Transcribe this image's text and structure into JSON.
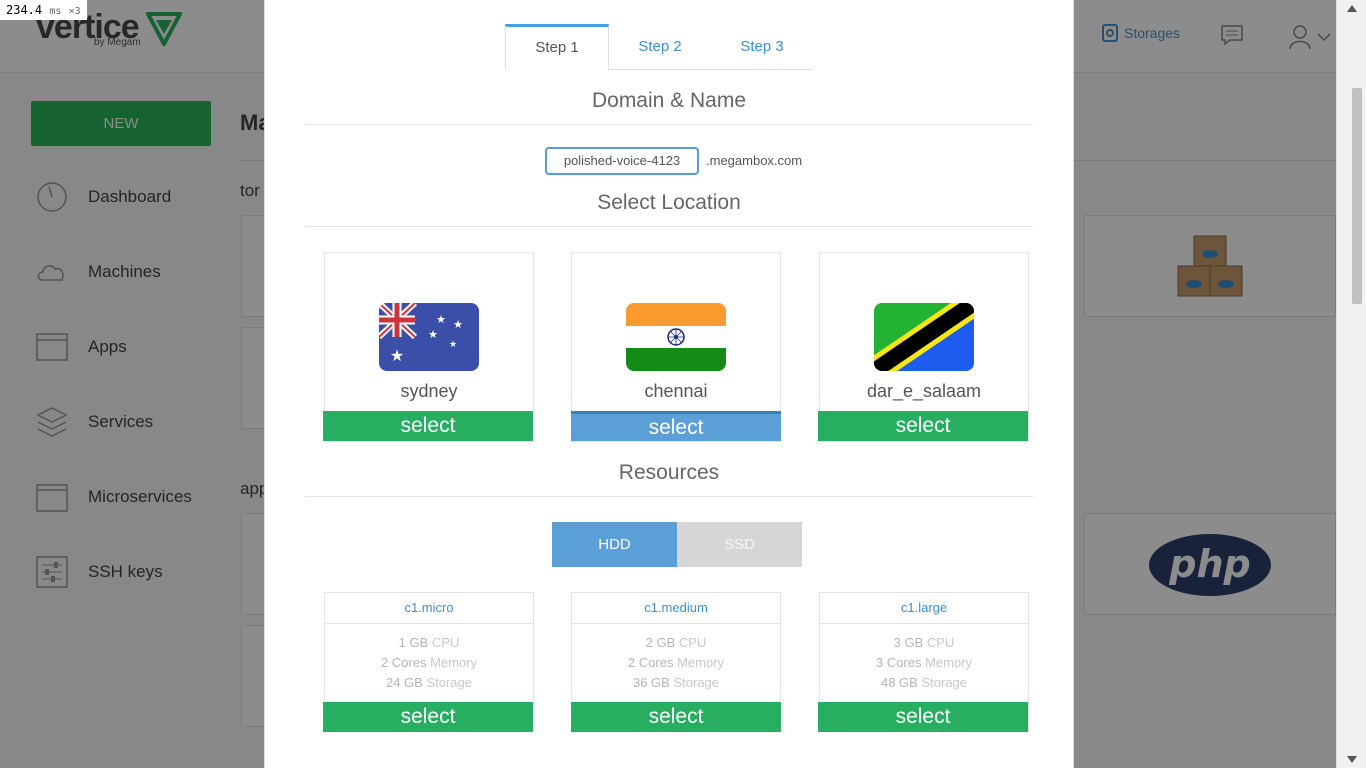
{
  "perf": {
    "value": "234.4",
    "unit": "ms",
    "mult": "×3"
  },
  "app": {
    "logo": "vertice",
    "logo_sub": "by Megam",
    "top_nav": {
      "storages_label": "Storages"
    },
    "new_button": "NEW",
    "sidebar": {
      "items": [
        {
          "label": "Dashboard",
          "icon": "dashboard-icon"
        },
        {
          "label": "Machines",
          "icon": "cloud-icon"
        },
        {
          "label": "Apps",
          "icon": "window-icon"
        },
        {
          "label": "Services",
          "icon": "layers-icon"
        },
        {
          "label": "Microservices",
          "icon": "box-icon"
        },
        {
          "label": "SSH keys",
          "icon": "sliders-icon"
        }
      ]
    },
    "bg_fragments": {
      "title_partial": "Ma",
      "section1_partial": "tor",
      "section2_partial": "app"
    }
  },
  "modal": {
    "tabs": [
      {
        "label": "Step 1",
        "active": true
      },
      {
        "label": "Step 2",
        "active": false
      },
      {
        "label": "Step 3",
        "active": false
      }
    ],
    "domain_section": {
      "title": "Domain & Name",
      "name_value": "polished-voice-4123",
      "domain_suffix": ".megambox.com"
    },
    "location_section": {
      "title": "Select Location",
      "locations": [
        {
          "name": "sydney",
          "flag": "australia-flag",
          "button": "select",
          "selected": false
        },
        {
          "name": "chennai",
          "flag": "india-flag",
          "button": "select",
          "selected": true
        },
        {
          "name": "dar_e_salaam",
          "flag": "tanzania-flag",
          "button": "select",
          "selected": false
        }
      ]
    },
    "resources_section": {
      "title": "Resources",
      "storage_types": [
        {
          "label": "HDD",
          "active": true
        },
        {
          "label": "SSD",
          "active": false
        }
      ],
      "plans": [
        {
          "name": "c1.micro",
          "cpu_value": "1 GB",
          "cpu_label": "CPU",
          "mem_value": "2 Cores",
          "mem_label": "Memory",
          "storage_value": "24 GB",
          "storage_label": "Storage",
          "button": "select"
        },
        {
          "name": "c1.medium",
          "cpu_value": "2 GB",
          "cpu_label": "CPU",
          "mem_value": "2 Cores",
          "mem_label": "Memory",
          "storage_value": "36 GB",
          "storage_label": "Storage",
          "button": "select"
        },
        {
          "name": "c1.large",
          "cpu_value": "3 GB",
          "cpu_label": "CPU",
          "mem_value": "3 Cores",
          "mem_label": "Memory",
          "storage_value": "48 GB",
          "storage_label": "Storage",
          "button": "select"
        }
      ]
    }
  },
  "colors": {
    "green": "#27ae60",
    "blue": "#5b9fd8",
    "link": "#3d8fd1"
  }
}
